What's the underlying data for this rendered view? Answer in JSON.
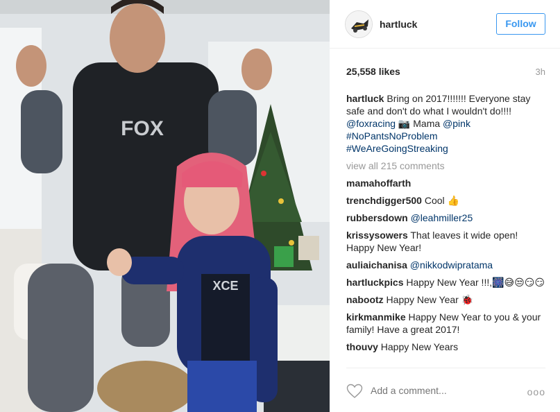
{
  "header": {
    "username": "hartluck",
    "follow_label": "Follow"
  },
  "stats": {
    "likes": "25,558 likes",
    "time": "3h"
  },
  "caption": {
    "username": "hartluck",
    "text1": " Bring on 2017!!!!!!! Everyone stay safe and don't do what I wouldn't do!!!! ",
    "mention1": "@foxracing",
    "camera_emoji": "📷",
    "text2": " Mama ",
    "mention2": "@pink",
    "hashtag1": "#NoPantsNoProblem",
    "hashtag2": "#WeAreGoingStreaking"
  },
  "view_all": "view all 215 comments",
  "comments": [
    {
      "user": "mamahoffarth",
      "text": ""
    },
    {
      "user": "trenchdigger500",
      "text": " Cool 👍"
    },
    {
      "user": "rubbersdown",
      "text": " ",
      "mention": "@leahmiller25"
    },
    {
      "user": "krissysowers",
      "text": " That leaves it wide open! Happy New Year!"
    },
    {
      "user": "auliaichanisa",
      "text": " ",
      "mention": "@nikkodwipratama"
    },
    {
      "user": "hartluckpics",
      "text": " Happy New Year !!!,🎆😅😒😏😏"
    },
    {
      "user": "nabootz",
      "text": " Happy New Year 🐞"
    },
    {
      "user": "kirkmanmike",
      "text": " Happy New Year to you & your family! Have a great 2017!"
    },
    {
      "user": "thouvy",
      "text": " Happy New Years"
    }
  ],
  "footer": {
    "add_comment_placeholder": "Add a comment...",
    "more_label": "ooo"
  },
  "icons": {
    "heart": "heart-icon",
    "avatar": "avatar-logo",
    "more": "ellipsis-icon"
  },
  "colors": {
    "link": "#003569",
    "follow_blue": "#3897f0",
    "muted": "#999999",
    "text": "#262626"
  }
}
